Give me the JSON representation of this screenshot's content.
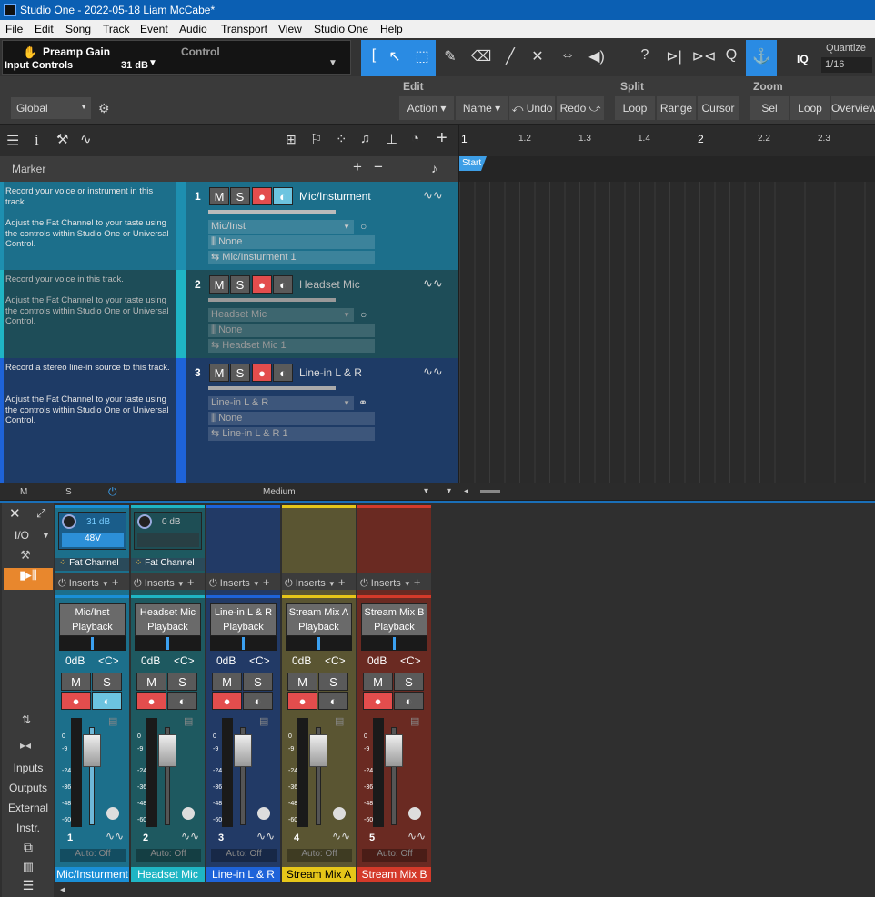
{
  "window": {
    "title": "Studio One - 2022-05-18 Liam McCabe*"
  },
  "menu": [
    "File",
    "Edit",
    "Song",
    "Track",
    "Event",
    "Audio",
    "Transport",
    "View",
    "Studio One",
    "Help"
  ],
  "control": {
    "param": "Preamp Gain",
    "section": "Control",
    "device": "Input Controls",
    "value": "31 dB"
  },
  "quantize": {
    "label": "Quantize",
    "value": "1/16"
  },
  "iq": "IQ",
  "global": "Global",
  "edit": {
    "header": "Edit",
    "action": "Action",
    "name": "Name",
    "undo": "Undo",
    "redo": "Redo"
  },
  "split": {
    "header": "Split",
    "loop": "Loop",
    "range": "Range",
    "cursor": "Cursor"
  },
  "zoom": {
    "header": "Zoom",
    "sel": "Sel",
    "loop": "Loop",
    "overview": "Overview"
  },
  "marker": {
    "label": "Marker",
    "start": "Start"
  },
  "ruler": [
    "1",
    "1.2",
    "1.3",
    "1.4",
    "2",
    "2.2",
    "2.3"
  ],
  "tracks": [
    {
      "num": "1",
      "name": "Mic/Insturment",
      "note1": "Record your voice or instrument in this track.",
      "note2": "Adjust the Fat Channel to your taste using the controls within Studio One or Universal Control.",
      "input": "Mic/Inst",
      "dd2": "None",
      "dd3": "Mic/Insturment 1",
      "color": "#1e8fb0",
      "bg": "#1c6f8b"
    },
    {
      "num": "2",
      "name": "Headset Mic",
      "note1": "Record your voice in this track.",
      "note2": "Adjust the Fat Channel to your taste using the controls within Studio One or Universal Control.",
      "input": "Headset Mic",
      "dd2": "None",
      "dd3": "Headset Mic 1",
      "color": "#1fb5c4",
      "bg": "#1e4d58"
    },
    {
      "num": "3",
      "name": "Line-in L & R",
      "note1": "Record a stereo line-in source to this track.",
      "note2": "Adjust the Fat Channel to your taste using the controls within Studio One or Universal Control.",
      "input": "Line-in L & R",
      "dd2": "None",
      "dd3": "Line-in L & R 1",
      "color": "#1e63d9",
      "bg": "#1e3b66"
    }
  ],
  "bottom": {
    "m": "M",
    "s": "S",
    "size": "Medium"
  },
  "mixerLeft": {
    "io": "I/O",
    "inputs": "Inputs",
    "outputs": "Outputs",
    "external": "External",
    "instr": "Instr."
  },
  "channels": [
    {
      "num": "1",
      "name": "Mic/Insturment",
      "playback": "Mic/Inst Playback",
      "gain": "31 dB",
      "phantom": "48V",
      "fat": "Fat Channel",
      "color": "#1a8fd6",
      "body": "#1c6f8b"
    },
    {
      "num": "2",
      "name": "Headset Mic",
      "playback": "Headset Mic Playback",
      "gain": "0 dB",
      "phantom": "",
      "fat": "Fat Channel",
      "color": "#1fb5c4",
      "body": "#1e5960"
    },
    {
      "num": "3",
      "name": "Line-in L & R",
      "playback": "Line-in L & R Playback",
      "gain": "",
      "phantom": "",
      "fat": "",
      "color": "#1e63d9",
      "body": "#223a66"
    },
    {
      "num": "4",
      "name": "Stream Mix A",
      "playback": "Stream Mix A Playback",
      "gain": "",
      "phantom": "",
      "fat": "",
      "color": "#e6c619",
      "body": "#5a5532"
    },
    {
      "num": "5",
      "name": "Stream Mix B",
      "playback": "Stream Mix B Playback",
      "gain": "",
      "phantom": "",
      "fat": "",
      "color": "#d43a2a",
      "body": "#6a2a22"
    }
  ],
  "strip": {
    "inserts": "Inserts",
    "odb": "0dB",
    "center": "<C>",
    "m": "M",
    "s": "S",
    "auto": "Auto: Off"
  },
  "scale": [
    "0",
    "-9",
    "-24",
    "-36",
    "-48",
    "-60"
  ]
}
